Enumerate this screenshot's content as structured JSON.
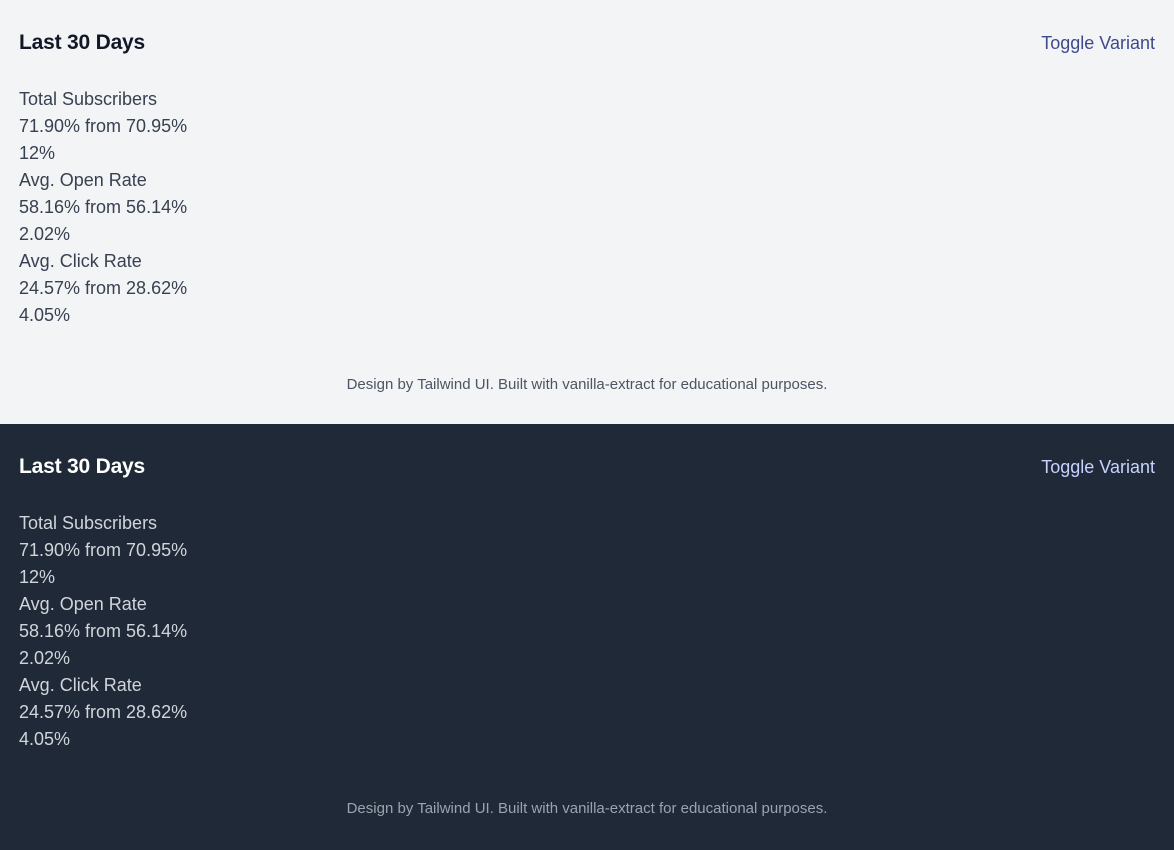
{
  "panels": [
    {
      "variant": "light",
      "title": "Last 30 Days",
      "toggle_label": "Toggle Variant",
      "stats": [
        {
          "name": "Total Subscribers",
          "value": "71.90% from 70.95%",
          "change": "12%"
        },
        {
          "name": "Avg. Open Rate",
          "value": "58.16% from 56.14%",
          "change": "2.02%"
        },
        {
          "name": "Avg. Click Rate",
          "value": "24.57% from 28.62%",
          "change": "4.05%"
        }
      ],
      "footer": "Design by Tailwind UI. Built with vanilla-extract for educational purposes."
    },
    {
      "variant": "dark",
      "title": "Last 30 Days",
      "toggle_label": "Toggle Variant",
      "stats": [
        {
          "name": "Total Subscribers",
          "value": "71.90% from 70.95%",
          "change": "12%"
        },
        {
          "name": "Avg. Open Rate",
          "value": "58.16% from 56.14%",
          "change": "2.02%"
        },
        {
          "name": "Avg. Click Rate",
          "value": "24.57% from 28.62%",
          "change": "4.05%"
        }
      ],
      "footer": "Design by Tailwind UI. Built with vanilla-extract for educational purposes."
    }
  ],
  "colors": {
    "light_bg": "#f3f4f6",
    "dark_bg": "#1f2937",
    "light_link": "#3e4a8c",
    "dark_link": "#c7d2fe"
  }
}
